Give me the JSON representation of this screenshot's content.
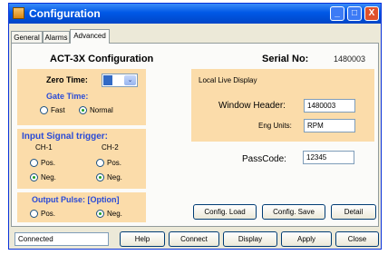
{
  "window": {
    "title": "Configuration",
    "controls": {
      "minimize": "_",
      "maximize": "□",
      "close": "X"
    },
    "icon": "app-config-icon"
  },
  "tabs": [
    {
      "label": "General",
      "active": false
    },
    {
      "label": "Alarms",
      "active": false
    },
    {
      "label": "Advanced",
      "active": true
    }
  ],
  "header": {
    "device_title": "ACT-3X Configuration",
    "serial_label": "Serial No:",
    "serial_value": "1480003"
  },
  "left": {
    "zero_time": {
      "label": "Zero Time:",
      "value": "",
      "arrow": "⌄"
    },
    "gate_time": {
      "label": "Gate Time:",
      "options": [
        {
          "label": "Fast",
          "checked": false
        },
        {
          "label": "Normal",
          "checked": true
        }
      ]
    },
    "input_trigger": {
      "label": "Input Signal trigger:",
      "ch1": {
        "label": "CH-1",
        "pos": "Pos.",
        "neg": "Neg.",
        "selected": "neg"
      },
      "ch2": {
        "label": "CH-2",
        "pos": "Pos.",
        "neg": "Neg.",
        "selected": "neg"
      }
    },
    "output_pulse": {
      "label": "Output Pulse: [Option]",
      "pos": "Pos.",
      "neg": "Neg.",
      "selected": "neg"
    }
  },
  "live_display": {
    "label": "Local Live Display",
    "window_header_label": "Window Header:",
    "window_header_value": "1480003",
    "eng_units_label": "Eng Units:",
    "eng_units_value": "RPM"
  },
  "passcode": {
    "label": "PassCode:",
    "value": "12345"
  },
  "panel_buttons": {
    "config_load": "Config. Load",
    "config_save": "Config. Save",
    "detail": "Detail"
  },
  "bottom": {
    "status": "Connected",
    "buttons": {
      "help": "Help",
      "connect": "Connect",
      "display": "Display",
      "apply": "Apply",
      "close": "Close"
    }
  },
  "colors": {
    "group_bg": "#fbdcaa",
    "group_title": "#2a4bd7",
    "titlebar": "#0058e6",
    "radio_on": "#21a121"
  }
}
